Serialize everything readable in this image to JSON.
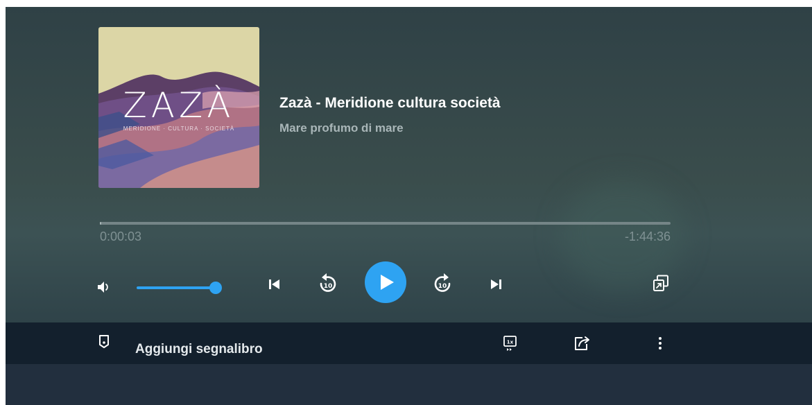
{
  "episode": {
    "podcast_title": "Zazà - Meridione cultura società",
    "episode_title": "Mare profumo di mare",
    "artwork": {
      "logo_text": "ZAZÀ",
      "tagline": "MERIDIONE · CULTURA · SOCIETÀ"
    }
  },
  "playback": {
    "elapsed": "0:00:03",
    "remaining": "-1:44:36",
    "progress_fraction": 0.0005,
    "volume_fraction": 1.0,
    "state": "paused"
  },
  "controls": {
    "volume_icon": "speaker-icon",
    "previous_icon": "skip-previous-icon",
    "rewind_icon": "rewind-10-icon",
    "rewind_seconds": "10",
    "play_icon": "play-icon",
    "forward_icon": "forward-10-icon",
    "forward_seconds": "10",
    "next_icon": "skip-next-icon",
    "popout_icon": "popout-window-icon"
  },
  "toolbar": {
    "bookmark_label": "Aggiungi segnalibro",
    "speed_label": "1x",
    "speed_icon": "playback-speed-icon",
    "share_icon": "share-icon",
    "more_icon": "more-vertical-icon"
  },
  "colors": {
    "accent": "#2ea3f2",
    "toolbar_background": "#13202d",
    "player_background": "#34484a"
  }
}
